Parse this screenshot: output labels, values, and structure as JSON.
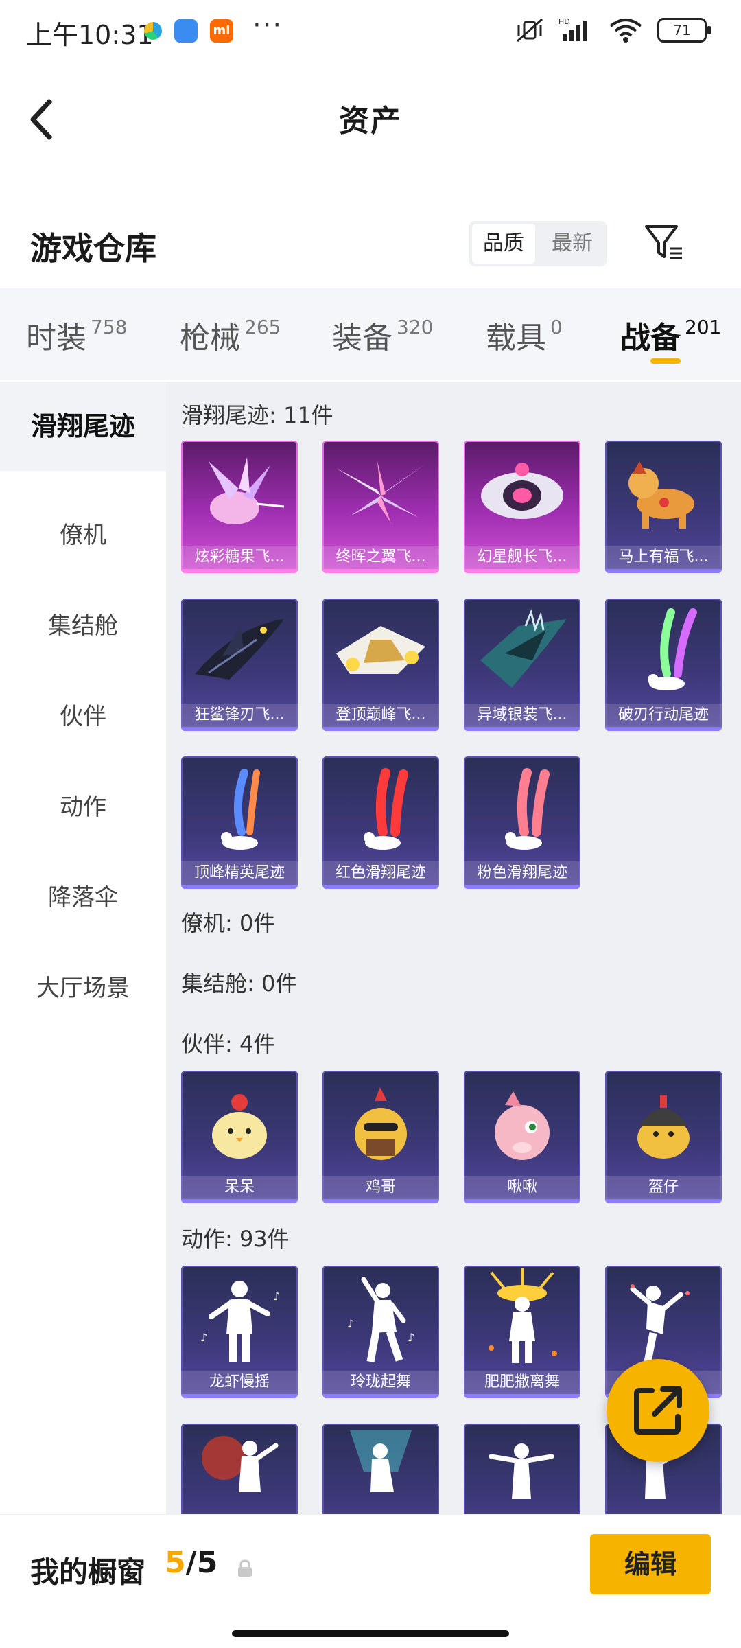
{
  "status_bar": {
    "time": "上午10:31",
    "more": "···",
    "battery": "71"
  },
  "header": {
    "title": "资产"
  },
  "warehouse": {
    "title": "游戏仓库",
    "sort_quality": "品质",
    "sort_latest": "最新"
  },
  "tabs": [
    {
      "label": "时装",
      "count": "758"
    },
    {
      "label": "枪械",
      "count": "265"
    },
    {
      "label": "装备",
      "count": "320"
    },
    {
      "label": "载具",
      "count": "0"
    },
    {
      "label": "战备",
      "count": "201"
    }
  ],
  "sidebar": [
    "滑翔尾迹",
    "僚机",
    "集结舱",
    "伙伴",
    "动作",
    "降落伞",
    "大厅场景"
  ],
  "sections": {
    "glide": {
      "label": "滑翔尾迹: 11件",
      "items": [
        "炫彩糖果飞...",
        "终晖之翼飞...",
        "幻星舰长飞...",
        "马上有福飞...",
        "狂鲨锋刃飞...",
        "登顶巅峰飞...",
        "异域银装飞...",
        "破刃行动尾迹",
        "顶峰精英尾迹",
        "红色滑翔尾迹",
        "粉色滑翔尾迹"
      ]
    },
    "wingman": {
      "label": "僚机: 0件"
    },
    "capsule": {
      "label": "集结舱: 0件"
    },
    "partner": {
      "label": "伙伴: 4件",
      "items": [
        "呆呆",
        "鸡哥",
        "啾啾",
        "盔仔"
      ]
    },
    "emote": {
      "label": "动作: 93件",
      "items": [
        "龙虾慢摇",
        "玲珑起舞",
        "肥肥撒离舞",
        ""
      ]
    }
  },
  "bottom": {
    "cabinet_label": "我的橱窗",
    "used": "5",
    "total": "/5",
    "edit": "编辑"
  },
  "colors": {
    "accent": "#f6b400",
    "card_purple": "#3c3877",
    "card_pink": "#a12fb3"
  }
}
